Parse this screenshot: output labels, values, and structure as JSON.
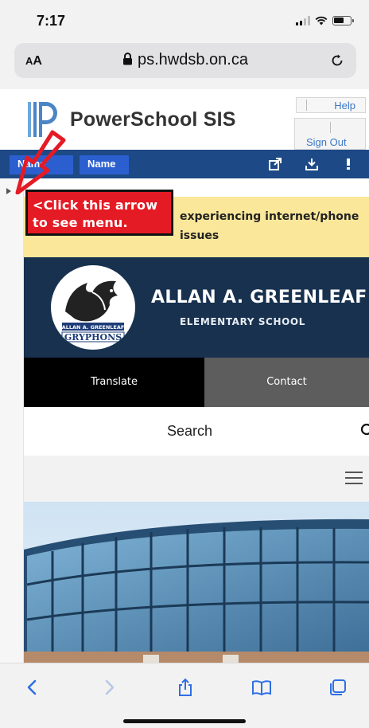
{
  "status_bar": {
    "time": "7:17"
  },
  "address_bar": {
    "text_size_label_small": "A",
    "text_size_label_big": "A",
    "url": "ps.hwdsb.on.ca"
  },
  "powerschool": {
    "title": "PowerSchool SIS",
    "help": "Help",
    "sign_out": "Sign Out",
    "nav_names": [
      "Name",
      "Name"
    ]
  },
  "callout": {
    "text_line1": "<Click this arrow",
    "text_line2": "to see menu."
  },
  "alert": {
    "text_line1": "experiencing internet/phone",
    "text_line2": "issues"
  },
  "school": {
    "name": "ALLAN A. GREENLEAF",
    "subtitle": "ELEMENTARY SCHOOL",
    "logo_text_top": "ALLAN A. GREENLEAF",
    "logo_text_bottom": "GRYPHONS"
  },
  "buttons": {
    "translate": "Translate",
    "contact": "Contact"
  },
  "search": {
    "label": "Search"
  },
  "icons": {
    "lock": "lock-icon",
    "reload": "reload-icon",
    "external": "external-link-icon",
    "download": "download-icon",
    "alert": "exclamation-icon",
    "back": "back-arrow-icon",
    "forward": "forward-arrow-icon",
    "share": "share-icon",
    "bookmarks": "bookmarks-icon",
    "tabs": "tabs-icon"
  },
  "colors": {
    "ps_nav": "#1d4a86",
    "name_chip": "#2b5fd0",
    "callout_red": "#e41b24",
    "alert_yellow": "#fbe79a",
    "school_navy": "#17314f"
  }
}
